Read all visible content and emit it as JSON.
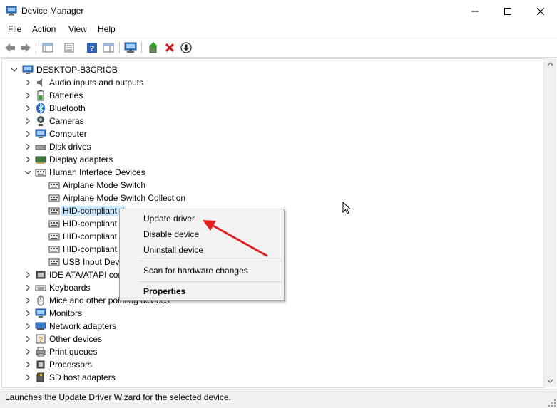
{
  "window": {
    "title": "Device Manager",
    "minimize_glyph": "—",
    "maximize_glyph": "☐",
    "close_glyph": "✕"
  },
  "menu": [
    "File",
    "Action",
    "View",
    "Help"
  ],
  "toolbar": {
    "buttons": [
      "back-icon",
      "forward-icon",
      "console-tree-icon",
      "properties-icon",
      "help-icon",
      "action-pane-icon",
      "monitor-icon",
      "update-driver-icon",
      "uninstall-icon",
      "download-icon"
    ]
  },
  "tree": {
    "root": "DESKTOP-B3CRIOB",
    "categories": [
      "Audio inputs and outputs",
      "Batteries",
      "Bluetooth",
      "Cameras",
      "Computer",
      "Disk drives",
      "Display adapters",
      "Human Interface Devices",
      "IDE ATA/ATAPI con",
      "Keyboards",
      "Mice and other pointing devices",
      "Monitors",
      "Network adapters",
      "Other devices",
      "Print queues",
      "Processors",
      "SD host adapters"
    ],
    "hid_children": [
      "Airplane Mode Switch",
      "Airplane Mode Switch Collection",
      "HID-compliant",
      "HID-compliant",
      "HID-compliant",
      "HID-compliant",
      "USB Input Devi"
    ],
    "selected_item_text": "HID-compliant d"
  },
  "context_menu": {
    "items": [
      "Update driver",
      "Disable device",
      "Uninstall device",
      "Scan for hardware changes",
      "Properties"
    ]
  },
  "status": {
    "text": "Launches the Update Driver Wizard for the selected device."
  },
  "colors": {
    "selection": "#cce8ff",
    "arrow": "#e02020",
    "uninstall_red": "#d41a1a"
  }
}
